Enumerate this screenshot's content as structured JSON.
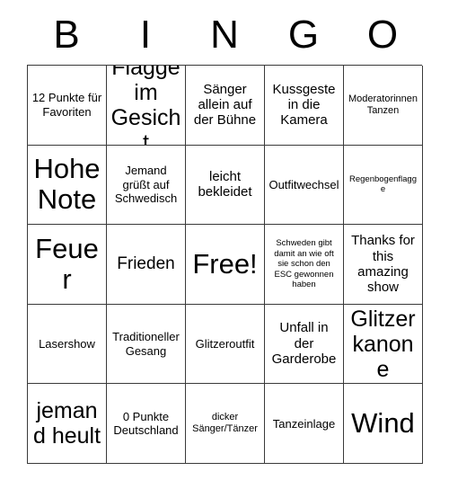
{
  "card": {
    "title": "BINGO",
    "header_letters": [
      "B",
      "I",
      "N",
      "G",
      "O"
    ],
    "grid": {
      "rows": 5,
      "columns": 5,
      "border_color": "#3a3a3a",
      "background_color": "#ffffff",
      "text_color": "#000000"
    },
    "cells": [
      {
        "text": "12 Punkte für Favoriten",
        "size": "fs-s",
        "row": 1,
        "col": 1
      },
      {
        "text": "Flagge im Gesicht",
        "size": "fs-xl",
        "row": 1,
        "col": 2
      },
      {
        "text": "Sänger allein auf der Bühne",
        "size": "fs-m",
        "row": 1,
        "col": 3
      },
      {
        "text": "Kussgeste in die Kamera",
        "size": "fs-m",
        "row": 1,
        "col": 4
      },
      {
        "text": "Moderatorinnen Tanzen",
        "size": "fs-xs",
        "row": 1,
        "col": 5
      },
      {
        "text": "Hohe Note",
        "size": "fs-xxl",
        "row": 2,
        "col": 1
      },
      {
        "text": "Jemand grüßt auf Schwedisch",
        "size": "fs-s",
        "row": 2,
        "col": 2
      },
      {
        "text": "leicht bekleidet",
        "size": "fs-m",
        "row": 2,
        "col": 3
      },
      {
        "text": "Outfitwechsel",
        "size": "fs-s",
        "row": 2,
        "col": 4
      },
      {
        "text": "Regenbogenflagge",
        "size": "fs-xxs",
        "row": 2,
        "col": 5
      },
      {
        "text": "Feuer",
        "size": "fs-xxl",
        "row": 3,
        "col": 1
      },
      {
        "text": "Frieden",
        "size": "fs-l",
        "row": 3,
        "col": 2
      },
      {
        "text": "Free!",
        "size": "fs-xxl",
        "row": 3,
        "col": 3
      },
      {
        "text": "Schweden gibt damit an wie oft sie schon den ESC gewonnen haben",
        "size": "fs-xxs",
        "row": 3,
        "col": 4
      },
      {
        "text": "Thanks for this amazing show",
        "size": "fs-m",
        "row": 3,
        "col": 5
      },
      {
        "text": "Lasershow",
        "size": "fs-s",
        "row": 4,
        "col": 1
      },
      {
        "text": "Traditioneller Gesang",
        "size": "fs-s",
        "row": 4,
        "col": 2
      },
      {
        "text": "Glitzeroutfit",
        "size": "fs-s",
        "row": 4,
        "col": 3
      },
      {
        "text": "Unfall in der Garderobe",
        "size": "fs-m",
        "row": 4,
        "col": 4
      },
      {
        "text": "Glitzer kanone",
        "size": "fs-xl",
        "row": 4,
        "col": 5
      },
      {
        "text": "jemand heult",
        "size": "fs-xl",
        "row": 5,
        "col": 1
      },
      {
        "text": "0 Punkte Deutschland",
        "size": "fs-s",
        "row": 5,
        "col": 2
      },
      {
        "text": "dicker Sänger/Tänzer",
        "size": "fs-xs",
        "row": 5,
        "col": 3
      },
      {
        "text": "Tanzeinlage",
        "size": "fs-s",
        "row": 5,
        "col": 4
      },
      {
        "text": "Wind",
        "size": "fs-xxl",
        "row": 5,
        "col": 5
      }
    ]
  }
}
